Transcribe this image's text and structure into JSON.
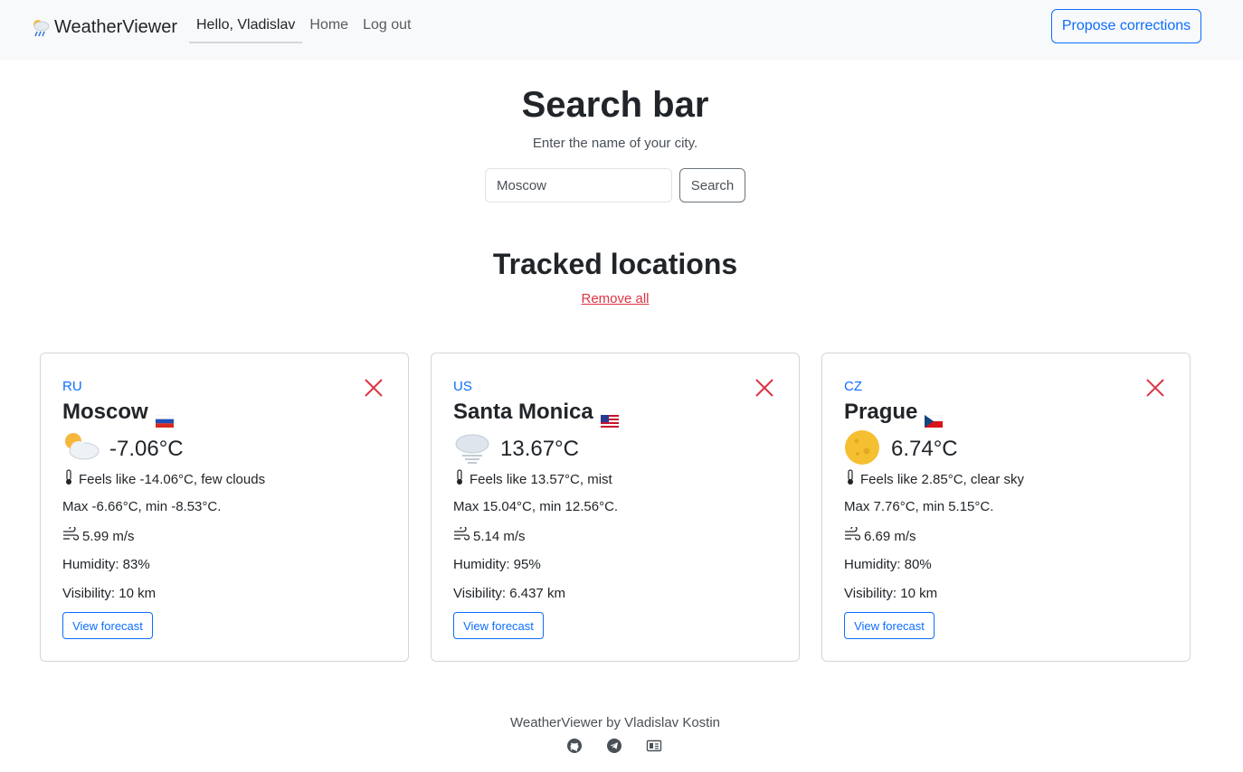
{
  "nav": {
    "brand": "WeatherViewer",
    "user_greeting": "Hello, Vladislav",
    "home": "Home",
    "logout": "Log out",
    "propose": "Propose corrections"
  },
  "search": {
    "title": "Search bar",
    "subtitle": "Enter the name of your city.",
    "value": "Moscow",
    "button": "Search"
  },
  "tracked": {
    "title": "Tracked locations",
    "remove_all": "Remove all"
  },
  "locations": [
    {
      "country": "RU",
      "city": "Moscow",
      "flag": "russia-flag",
      "weather_icon": "partly-cloudy-icon",
      "temp": "-7.06°C",
      "feels": "Feels like -14.06°C, few clouds",
      "maxmin": "Max -6.66°C, min -8.53°C.",
      "wind": "5.99 m/s",
      "humidity": "Humidity: 83%",
      "visibility": "Visibility: 10 km",
      "forecast": "View forecast"
    },
    {
      "country": "US",
      "city": "Santa Monica",
      "flag": "usa-flag",
      "weather_icon": "mist-icon",
      "temp": "13.67°C",
      "feels": "Feels like 13.57°C, mist",
      "maxmin": "Max 15.04°C, min 12.56°C.",
      "wind": "5.14 m/s",
      "humidity": "Humidity: 95%",
      "visibility": "Visibility: 6.437 km",
      "forecast": "View forecast"
    },
    {
      "country": "CZ",
      "city": "Prague",
      "flag": "czech-flag",
      "weather_icon": "moon-clear-sky-icon",
      "temp": "6.74°C",
      "feels": "Feels like 2.85°C, clear sky",
      "maxmin": "Max 7.76°C, min 5.15°C.",
      "wind": "6.69 m/s",
      "humidity": "Humidity: 80%",
      "visibility": "Visibility: 10 km",
      "forecast": "View forecast"
    }
  ],
  "footer": {
    "text": "WeatherViewer by Vladislav Kostin",
    "icons": [
      "github-icon",
      "telegram-icon",
      "resume-icon"
    ]
  },
  "colors": {
    "primary": "#0d6efd",
    "danger": "#dc3545",
    "navbar_bg": "#f8f9fa"
  }
}
